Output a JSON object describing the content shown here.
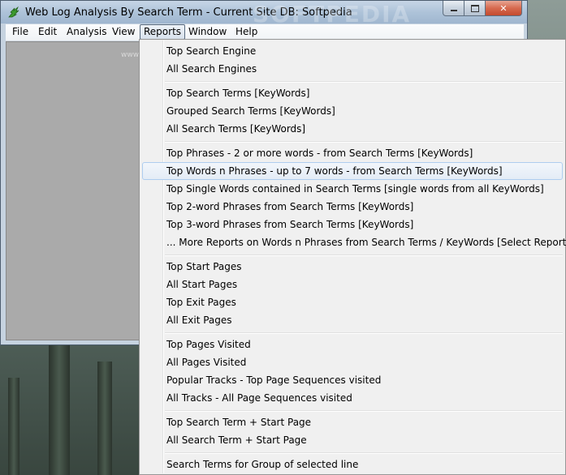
{
  "window": {
    "title": "Web Log Analysis By Search Term - Current Site DB: Softpedia",
    "watermark": "SOFTPEDIA",
    "watermark_small": "www.softpedia.com"
  },
  "menubar": {
    "items": [
      "File",
      "Edit",
      "Analysis",
      "View",
      "Reports",
      "Window",
      "Help"
    ],
    "active": "Reports"
  },
  "reports_menu": {
    "groups": [
      [
        "Top Search Engine",
        "All Search Engines"
      ],
      [
        "Top Search Terms [KeyWords]",
        "Grouped Search Terms [KeyWords]",
        "All Search Terms [KeyWords]"
      ],
      [
        "Top Phrases - 2 or more words - from Search Terms  [KeyWords]",
        "Top Words n Phrases - up to 7 words - from Search Terms [KeyWords]",
        "Top Single Words contained in Search Terms [single words from all KeyWords]",
        "Top 2-word Phrases from Search Terms [KeyWords]",
        "Top 3-word Phrases from Search Terms [KeyWords]",
        "... More Reports on Words n Phrases from Search Terms / KeyWords [Select Report]"
      ],
      [
        "Top Start Pages",
        "All Start Pages",
        "Top Exit Pages",
        "All Exit Pages"
      ],
      [
        "Top Pages Visited",
        "All Pages Visited",
        "Popular Tracks - Top Page Sequences visited",
        "All Tracks - All Page Sequences visited"
      ],
      [
        "Top Search Term + Start Page",
        "All Search Term + Start Page"
      ],
      [
        "Search Terms for Group of selected line"
      ]
    ],
    "highlighted": "Top Words n Phrases - up to 7 words - from Search Terms [KeyWords]"
  },
  "icons": {
    "app": "green-leaf-icon",
    "minimize": "minimize-icon",
    "maximize": "maximize-icon",
    "close": "close-icon"
  }
}
